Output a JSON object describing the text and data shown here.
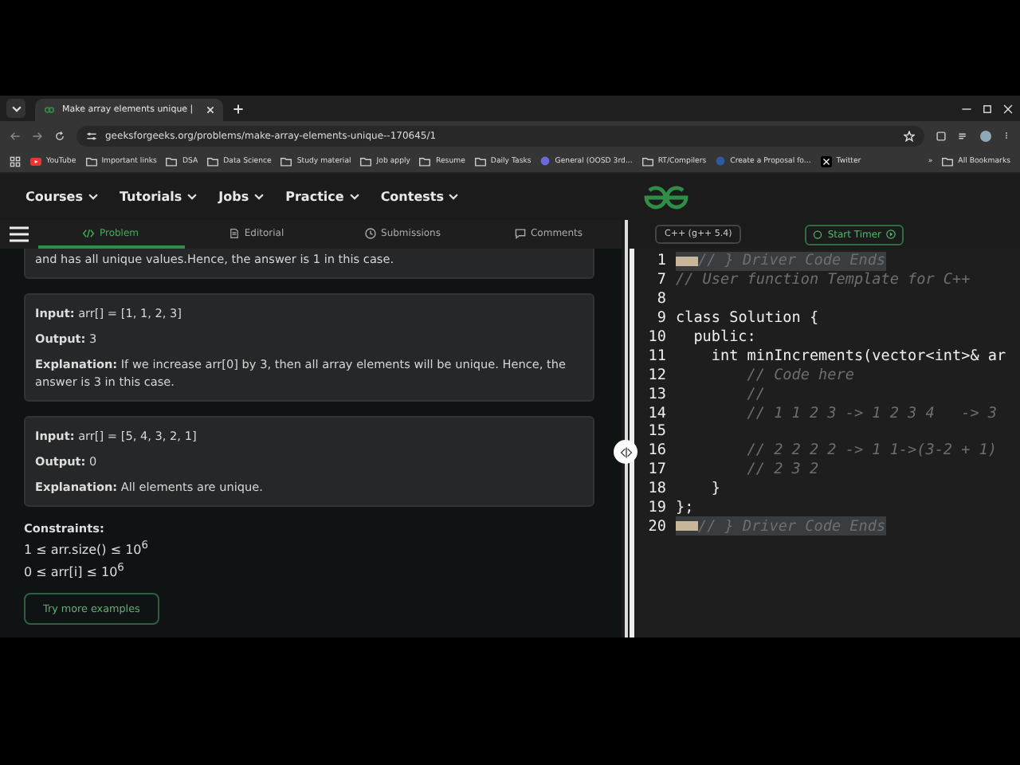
{
  "browser": {
    "tab_title": "Make array elements unique |",
    "url": "geeksforgeeks.org/problems/make-array-elements-unique--170645/1",
    "bookmarks": [
      {
        "label": "YouTube",
        "kind": "video"
      },
      {
        "label": "Important links",
        "kind": "folder"
      },
      {
        "label": "DSA",
        "kind": "folder"
      },
      {
        "label": "Data Science",
        "kind": "folder"
      },
      {
        "label": "Study material",
        "kind": "folder"
      },
      {
        "label": "Job apply",
        "kind": "folder"
      },
      {
        "label": "Resume",
        "kind": "folder"
      },
      {
        "label": "Daily Tasks",
        "kind": "folder"
      },
      {
        "label": "General (OOSD 3rd...",
        "kind": "app"
      },
      {
        "label": "RT/Compilers",
        "kind": "folder"
      },
      {
        "label": "Create a Proposal fo...",
        "kind": "web"
      },
      {
        "label": "Twitter",
        "kind": "x"
      }
    ],
    "overflow": "»",
    "all_bookmarks": "All Bookmarks"
  },
  "site_nav": [
    "Courses",
    "Tutorials",
    "Jobs",
    "Practice",
    "Contests"
  ],
  "problem_tabs": [
    {
      "label": "Problem",
      "selected": true
    },
    {
      "label": "Editorial",
      "selected": false
    },
    {
      "label": "Submissions",
      "selected": false
    },
    {
      "label": "Comments",
      "selected": false
    }
  ],
  "partial_explanation": "and has all unique values.Hence, the answer is 1 in this case.",
  "examples": [
    {
      "rows": [
        {
          "label": "Input:",
          "value": "arr[] = [1, 1, 2, 3]"
        },
        {
          "label": "Output:",
          "value": "3"
        },
        {
          "label": "Explanation:",
          "value": "If we increase arr[0] by 3, then all array elements will be unique. Hence, the answer is 3 in this case."
        }
      ]
    },
    {
      "rows": [
        {
          "label": "Input:",
          "value": "arr[] = [5, 4, 3, 2, 1]"
        },
        {
          "label": "Output:",
          "value": "0"
        },
        {
          "label": "Explanation:",
          "value": "All elements are unique."
        }
      ]
    }
  ],
  "constraints": {
    "title": "Constraints:",
    "items": [
      "1 ≤ arr.size() ≤ 10$^{6}$",
      "0 ≤ arr[i] ≤ 10$^{6}$"
    ]
  },
  "more_button": "Try more examples",
  "editor": {
    "language": "C++ (g++ 5.4)",
    "timer_button": "Start Timer",
    "lines": [
      {
        "number": "1",
        "folded": true,
        "highlighted": true,
        "tokens": [
          {
            "text": "// } Driver Code Ends",
            "kind": "comment"
          }
        ]
      },
      {
        "number": "7",
        "folded": false,
        "highlighted": false,
        "tokens": [
          {
            "text": "// User function Template for C++",
            "kind": "comment"
          }
        ]
      },
      {
        "number": "8",
        "folded": false,
        "highlighted": false
      },
      {
        "number": "9",
        "folded": false,
        "highlighted": false,
        "tokens": [
          {
            "text": "class",
            "kind": "keyword"
          },
          {
            "text": " Solution {",
            "kind": "plain"
          }
        ]
      },
      {
        "number": "10",
        "folded": false,
        "highlighted": false,
        "tokens": [
          {
            "text": "  public:",
            "kind": "keyword"
          }
        ]
      },
      {
        "number": "11",
        "folded": false,
        "highlighted": false,
        "tokens": [
          {
            "text": "    int",
            "kind": "keyword"
          },
          {
            "text": " minIncrements(vector<",
            "kind": "plain"
          },
          {
            "text": "int",
            "kind": "keyword"
          },
          {
            "text": ">& ar",
            "kind": "plain"
          }
        ]
      },
      {
        "number": "12",
        "folded": false,
        "highlighted": false,
        "tokens": [
          {
            "text": "        // Code here",
            "kind": "comment"
          }
        ]
      },
      {
        "number": "13",
        "folded": false,
        "highlighted": false,
        "tokens": [
          {
            "text": "        //",
            "kind": "comment"
          }
        ]
      },
      {
        "number": "14",
        "folded": false,
        "highlighted": false,
        "tokens": [
          {
            "text": "        // 1 1 2 3 -> 1 2 3 4   -> 3",
            "kind": "comment"
          }
        ]
      },
      {
        "number": "15",
        "folded": false,
        "highlighted": false
      },
      {
        "number": "16",
        "folded": false,
        "highlighted": false,
        "tokens": [
          {
            "text": "        // 2 2 2 2 -> 1 1->(3-2 + 1)",
            "kind": "comment"
          }
        ]
      },
      {
        "number": "17",
        "folded": false,
        "highlighted": false,
        "tokens": [
          {
            "text": "        // 2 3 2",
            "kind": "comment"
          }
        ]
      },
      {
        "number": "18",
        "folded": false,
        "highlighted": false,
        "tokens": [
          {
            "text": "    }",
            "kind": "plain"
          }
        ]
      },
      {
        "number": "19",
        "folded": false,
        "highlighted": false,
        "tokens": [
          {
            "text": "};",
            "kind": "plain"
          }
        ]
      },
      {
        "number": "20",
        "folded": true,
        "highlighted": true,
        "tokens": [
          {
            "text": "// } Driver Code Ends",
            "kind": "comment"
          }
        ]
      }
    ]
  }
}
